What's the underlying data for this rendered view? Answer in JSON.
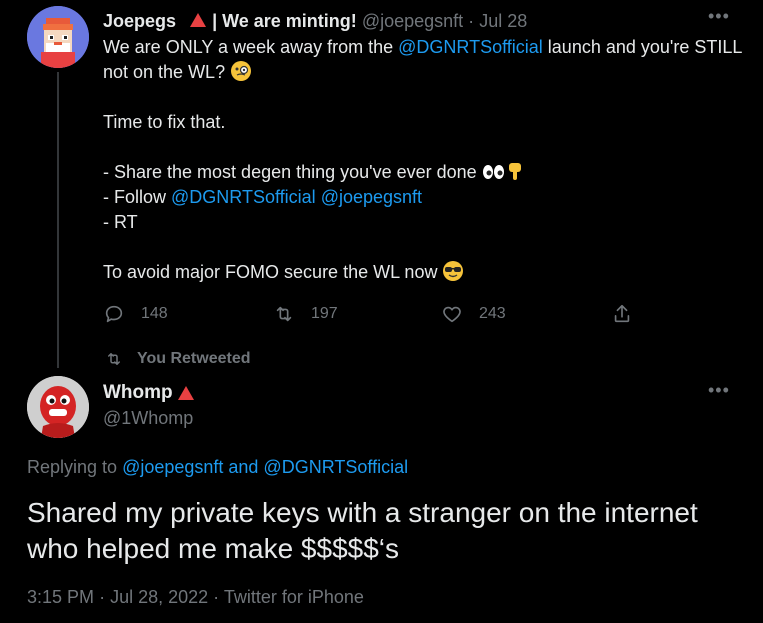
{
  "tweet1": {
    "name": "Joepegs",
    "name_suffix": " | We are minting!",
    "handle": "@joepegsnft",
    "dot": "·",
    "date": "Jul 28",
    "text_a": "We are ONLY a week away from the ",
    "mention_launch": "@DGNRTSofficial",
    "text_b": " launch and you're STILL not on the WL?",
    "line_fix": "Time to fix that.",
    "line_share": "- Share the most degen thing you've ever done",
    "line_follow_prefix": "- Follow ",
    "mention_follow1": "@DGNRTSofficial",
    "mention_follow2": "@joepegsnft",
    "line_rt": "- RT",
    "line_fomo": "To avoid major FOMO secure the WL now",
    "replies": "148",
    "retweets": "197",
    "likes": "243"
  },
  "retweeted_label": "You Retweeted",
  "tweet2": {
    "name": "Whomp",
    "handle": "@1Whomp",
    "replying_prefix": "Replying to ",
    "replying_users": "@joepegsnft and @DGNRTSofficial",
    "text": "Shared my private keys with a stranger on the internet who helped me make $$$$$‘s",
    "time": "3:15 PM",
    "date": "Jul 28, 2022",
    "source": "Twitter for iPhone",
    "dot": "·"
  },
  "more_label": "•••",
  "colors": {
    "background": "#000000",
    "text": "#e7e9ea",
    "muted": "#71767b",
    "link": "#1d9bf0",
    "accent_triangle": "#e84142"
  },
  "icons": [
    "reply-icon",
    "retweet-icon",
    "like-icon",
    "share-icon",
    "more-icon",
    "triangle-icon"
  ]
}
